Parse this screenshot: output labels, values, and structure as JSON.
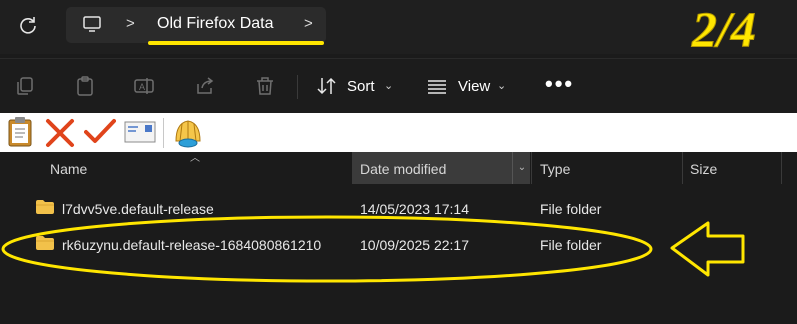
{
  "address": {
    "breadcrumb_sep_1": ">",
    "folder": "Old Firefox Data",
    "breadcrumb_sep_2": ">"
  },
  "annotation": {
    "step": "2/4",
    "highlight_color": "#ffe600"
  },
  "command_bar": {
    "sort_label": "Sort",
    "view_label": "View",
    "more_label": "•••",
    "caret": "⌄"
  },
  "columns": {
    "name": "Name",
    "date_modified": "Date modified",
    "type": "Type",
    "size": "Size"
  },
  "files": [
    {
      "name": "l7dvv5ve.default-release",
      "date": "14/05/2023 17:14",
      "type": "File folder",
      "size": ""
    },
    {
      "name": "rk6uzynu.default-release-1684080861210",
      "date": "10/09/2025 22:17",
      "type": "File folder",
      "size": ""
    }
  ],
  "icons": [
    "refresh-icon",
    "computer-icon",
    "copy-icon",
    "paste-icon",
    "rename-icon",
    "share-icon",
    "delete-icon",
    "sort-icon",
    "view-icon",
    "clipboard-icon",
    "cross-icon",
    "check-icon",
    "mail-icon",
    "shell-icon",
    "folder-icon",
    "arrow-annotation-icon"
  ]
}
